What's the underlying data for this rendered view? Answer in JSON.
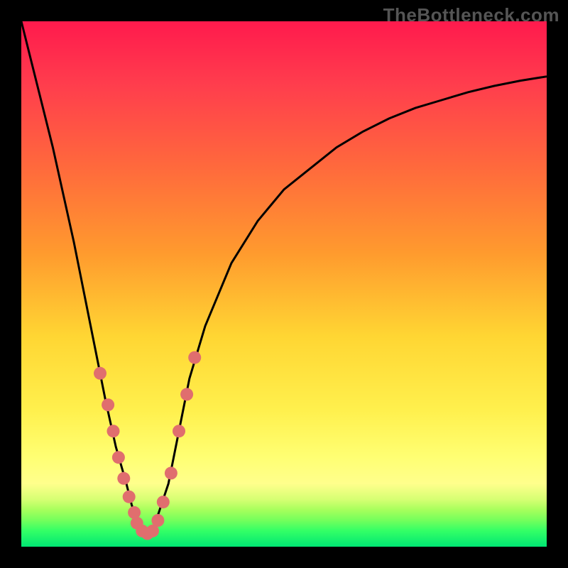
{
  "brand": "TheBottleneck.com",
  "colors": {
    "curve": "#000000",
    "marker_fill": "#e06e6e",
    "marker_stroke": "#c25a5a",
    "gradient_top": "#ff1a4d",
    "gradient_bottom": "#00e673"
  },
  "chart_data": {
    "type": "line",
    "title": "",
    "xlabel": "",
    "ylabel": "",
    "xlim": [
      0,
      100
    ],
    "ylim": [
      0,
      100
    ],
    "grid": false,
    "legend": false,
    "x": [
      0,
      2,
      4,
      6,
      8,
      10,
      12,
      14,
      16,
      18,
      20,
      21,
      22,
      23,
      24,
      25,
      26,
      28,
      30,
      32,
      35,
      40,
      45,
      50,
      55,
      60,
      65,
      70,
      75,
      80,
      85,
      90,
      95,
      100
    ],
    "y": [
      100,
      92,
      84,
      76,
      67,
      58,
      48,
      38,
      28,
      19,
      12,
      8,
      5,
      3,
      2,
      3,
      6,
      12,
      22,
      32,
      42,
      54,
      62,
      68,
      72,
      76,
      79,
      81.5,
      83.5,
      85,
      86.5,
      87.7,
      88.7,
      89.5
    ],
    "series": [
      {
        "name": "bottleneck-curve",
        "reads_from": [
          "x",
          "y"
        ]
      }
    ],
    "markers": {
      "x": [
        15,
        16.5,
        17.5,
        18.5,
        19.5,
        20.5,
        21.5,
        22,
        23,
        24,
        25,
        26,
        27,
        28.5,
        30,
        31.5,
        33
      ],
      "y": [
        33,
        27,
        22,
        17,
        13,
        9.5,
        6.5,
        4.5,
        3,
        2.5,
        3,
        5,
        8.5,
        14,
        22,
        29,
        36
      ]
    }
  }
}
